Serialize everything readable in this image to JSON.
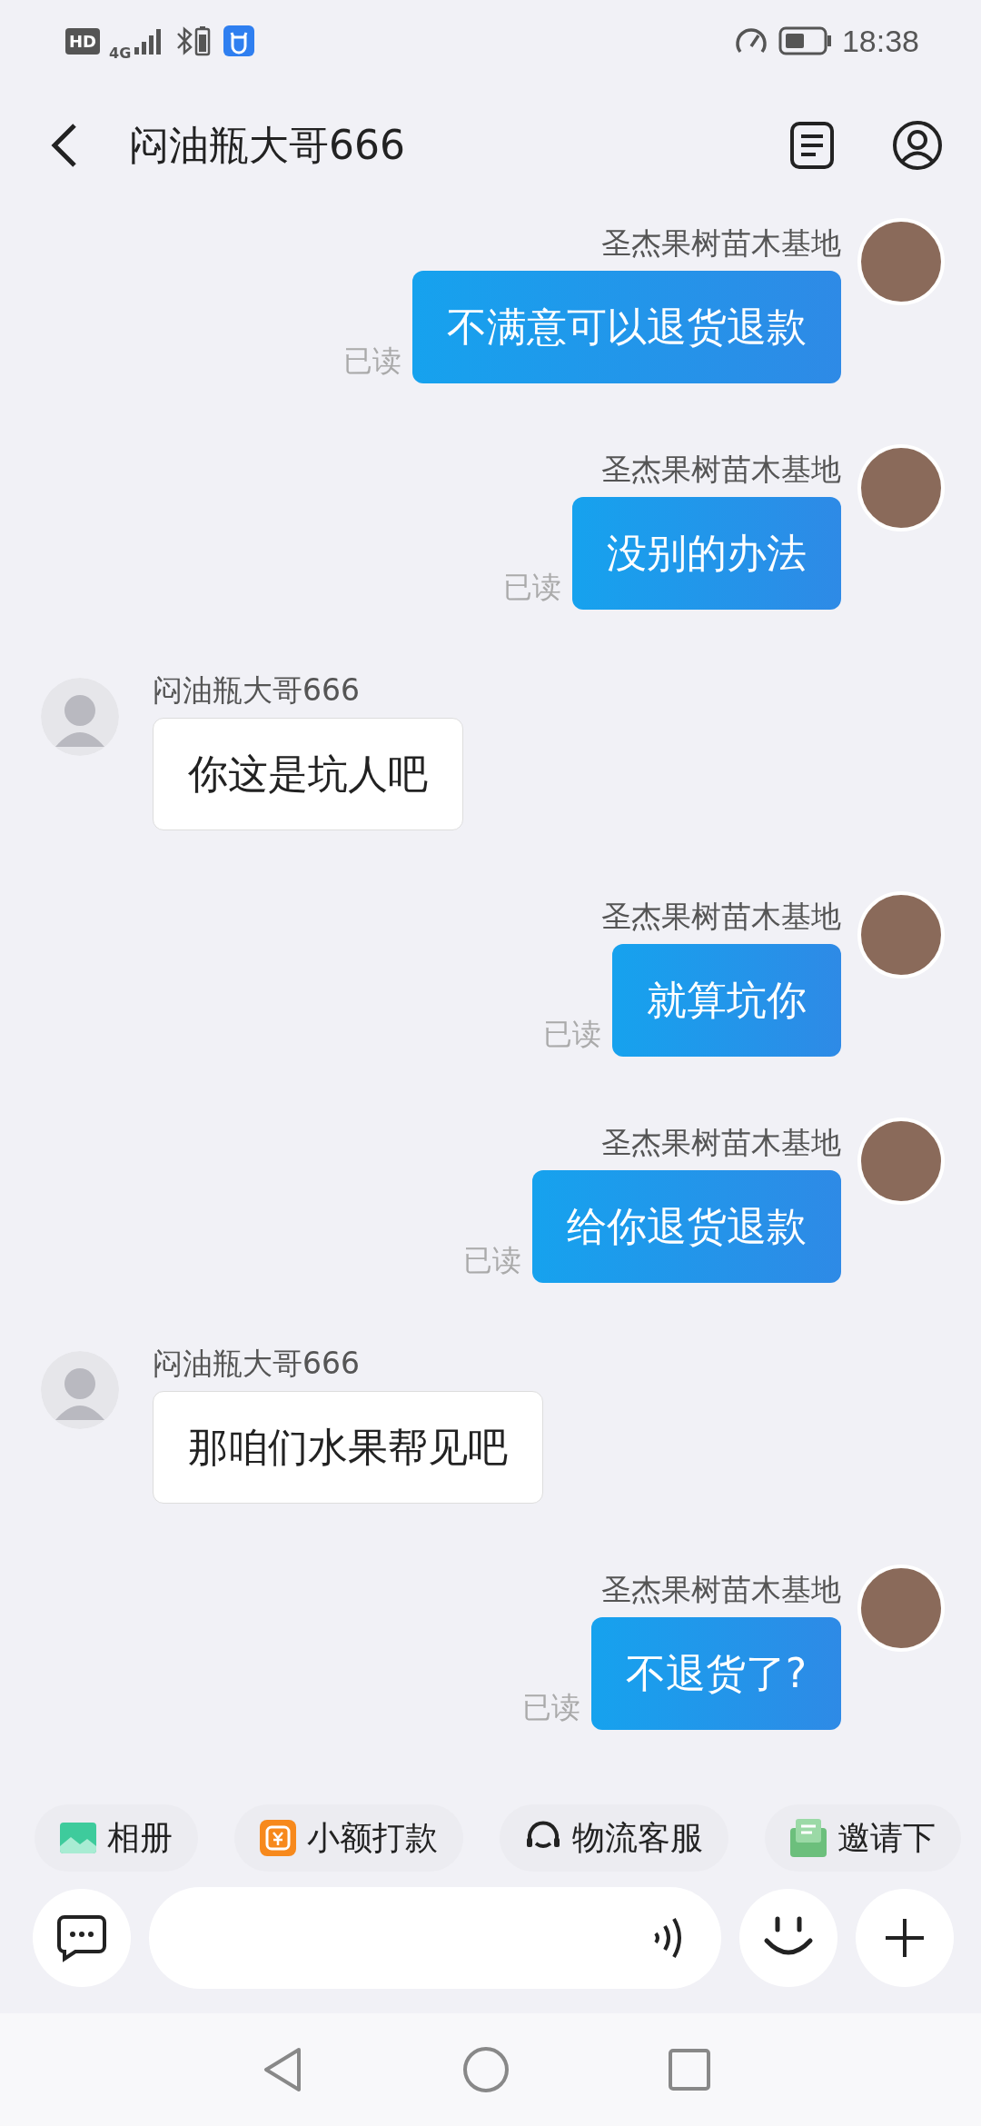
{
  "status_bar": {
    "hd": "HD",
    "network": "4G",
    "time": "18:38"
  },
  "header": {
    "title": "闷油瓶大哥666"
  },
  "messages": [
    {
      "kind": "sent",
      "sender": "圣杰果树苗木基地",
      "text": "不满意可以退货退款",
      "read_label": "已读"
    },
    {
      "kind": "sent",
      "sender": "圣杰果树苗木基地",
      "text": "没别的办法",
      "read_label": "已读"
    },
    {
      "kind": "received",
      "sender": "闷油瓶大哥666",
      "text": "你这是坑人吧"
    },
    {
      "kind": "sent",
      "sender": "圣杰果树苗木基地",
      "text": "就算坑你",
      "read_label": "已读"
    },
    {
      "kind": "sent",
      "sender": "圣杰果树苗木基地",
      "text": "给你退货退款",
      "read_label": "已读"
    },
    {
      "kind": "received",
      "sender": "闷油瓶大哥666",
      "text": "那咱们水果帮见吧"
    },
    {
      "kind": "sent",
      "sender": "圣杰果树苗木基地",
      "text": "不退货了?",
      "read_label": "已读"
    }
  ],
  "quick_actions": [
    {
      "kind": "album",
      "label": "相册"
    },
    {
      "kind": "payment",
      "label": "小额打款"
    },
    {
      "kind": "service",
      "label": "物流客服"
    },
    {
      "kind": "invite",
      "label": "邀请下"
    }
  ]
}
